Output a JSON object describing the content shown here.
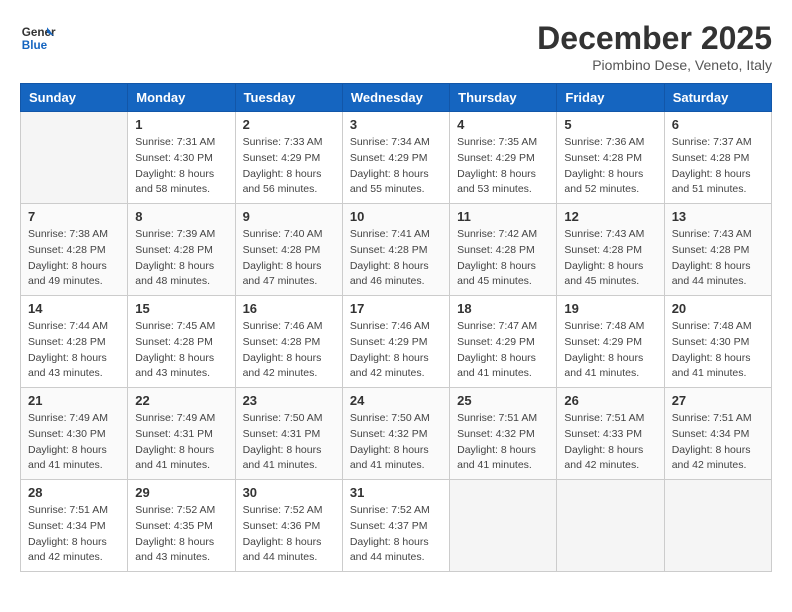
{
  "header": {
    "logo_line1": "General",
    "logo_line2": "Blue",
    "month": "December 2025",
    "location": "Piombino Dese, Veneto, Italy"
  },
  "weekdays": [
    "Sunday",
    "Monday",
    "Tuesday",
    "Wednesday",
    "Thursday",
    "Friday",
    "Saturday"
  ],
  "weeks": [
    [
      {
        "day": "",
        "info": ""
      },
      {
        "day": "1",
        "info": "Sunrise: 7:31 AM\nSunset: 4:30 PM\nDaylight: 8 hours\nand 58 minutes."
      },
      {
        "day": "2",
        "info": "Sunrise: 7:33 AM\nSunset: 4:29 PM\nDaylight: 8 hours\nand 56 minutes."
      },
      {
        "day": "3",
        "info": "Sunrise: 7:34 AM\nSunset: 4:29 PM\nDaylight: 8 hours\nand 55 minutes."
      },
      {
        "day": "4",
        "info": "Sunrise: 7:35 AM\nSunset: 4:29 PM\nDaylight: 8 hours\nand 53 minutes."
      },
      {
        "day": "5",
        "info": "Sunrise: 7:36 AM\nSunset: 4:28 PM\nDaylight: 8 hours\nand 52 minutes."
      },
      {
        "day": "6",
        "info": "Sunrise: 7:37 AM\nSunset: 4:28 PM\nDaylight: 8 hours\nand 51 minutes."
      }
    ],
    [
      {
        "day": "7",
        "info": "Sunrise: 7:38 AM\nSunset: 4:28 PM\nDaylight: 8 hours\nand 49 minutes."
      },
      {
        "day": "8",
        "info": "Sunrise: 7:39 AM\nSunset: 4:28 PM\nDaylight: 8 hours\nand 48 minutes."
      },
      {
        "day": "9",
        "info": "Sunrise: 7:40 AM\nSunset: 4:28 PM\nDaylight: 8 hours\nand 47 minutes."
      },
      {
        "day": "10",
        "info": "Sunrise: 7:41 AM\nSunset: 4:28 PM\nDaylight: 8 hours\nand 46 minutes."
      },
      {
        "day": "11",
        "info": "Sunrise: 7:42 AM\nSunset: 4:28 PM\nDaylight: 8 hours\nand 45 minutes."
      },
      {
        "day": "12",
        "info": "Sunrise: 7:43 AM\nSunset: 4:28 PM\nDaylight: 8 hours\nand 45 minutes."
      },
      {
        "day": "13",
        "info": "Sunrise: 7:43 AM\nSunset: 4:28 PM\nDaylight: 8 hours\nand 44 minutes."
      }
    ],
    [
      {
        "day": "14",
        "info": "Sunrise: 7:44 AM\nSunset: 4:28 PM\nDaylight: 8 hours\nand 43 minutes."
      },
      {
        "day": "15",
        "info": "Sunrise: 7:45 AM\nSunset: 4:28 PM\nDaylight: 8 hours\nand 43 minutes."
      },
      {
        "day": "16",
        "info": "Sunrise: 7:46 AM\nSunset: 4:28 PM\nDaylight: 8 hours\nand 42 minutes."
      },
      {
        "day": "17",
        "info": "Sunrise: 7:46 AM\nSunset: 4:29 PM\nDaylight: 8 hours\nand 42 minutes."
      },
      {
        "day": "18",
        "info": "Sunrise: 7:47 AM\nSunset: 4:29 PM\nDaylight: 8 hours\nand 41 minutes."
      },
      {
        "day": "19",
        "info": "Sunrise: 7:48 AM\nSunset: 4:29 PM\nDaylight: 8 hours\nand 41 minutes."
      },
      {
        "day": "20",
        "info": "Sunrise: 7:48 AM\nSunset: 4:30 PM\nDaylight: 8 hours\nand 41 minutes."
      }
    ],
    [
      {
        "day": "21",
        "info": "Sunrise: 7:49 AM\nSunset: 4:30 PM\nDaylight: 8 hours\nand 41 minutes."
      },
      {
        "day": "22",
        "info": "Sunrise: 7:49 AM\nSunset: 4:31 PM\nDaylight: 8 hours\nand 41 minutes."
      },
      {
        "day": "23",
        "info": "Sunrise: 7:50 AM\nSunset: 4:31 PM\nDaylight: 8 hours\nand 41 minutes."
      },
      {
        "day": "24",
        "info": "Sunrise: 7:50 AM\nSunset: 4:32 PM\nDaylight: 8 hours\nand 41 minutes."
      },
      {
        "day": "25",
        "info": "Sunrise: 7:51 AM\nSunset: 4:32 PM\nDaylight: 8 hours\nand 41 minutes."
      },
      {
        "day": "26",
        "info": "Sunrise: 7:51 AM\nSunset: 4:33 PM\nDaylight: 8 hours\nand 42 minutes."
      },
      {
        "day": "27",
        "info": "Sunrise: 7:51 AM\nSunset: 4:34 PM\nDaylight: 8 hours\nand 42 minutes."
      }
    ],
    [
      {
        "day": "28",
        "info": "Sunrise: 7:51 AM\nSunset: 4:34 PM\nDaylight: 8 hours\nand 42 minutes."
      },
      {
        "day": "29",
        "info": "Sunrise: 7:52 AM\nSunset: 4:35 PM\nDaylight: 8 hours\nand 43 minutes."
      },
      {
        "day": "30",
        "info": "Sunrise: 7:52 AM\nSunset: 4:36 PM\nDaylight: 8 hours\nand 44 minutes."
      },
      {
        "day": "31",
        "info": "Sunrise: 7:52 AM\nSunset: 4:37 PM\nDaylight: 8 hours\nand 44 minutes."
      },
      {
        "day": "",
        "info": ""
      },
      {
        "day": "",
        "info": ""
      },
      {
        "day": "",
        "info": ""
      }
    ]
  ]
}
